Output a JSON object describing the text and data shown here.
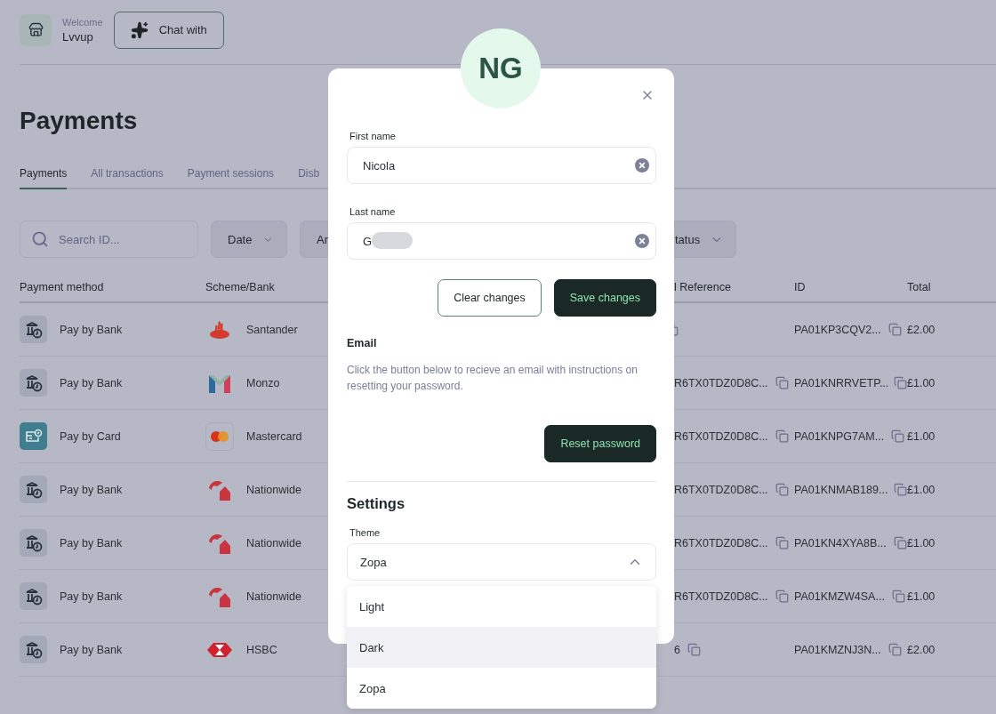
{
  "header": {
    "welcome": "Welcome",
    "name": "Lvvup",
    "chat_button": "Chat with"
  },
  "page_title": "Payments",
  "tabs": [
    {
      "label": "Payments",
      "selected": true
    },
    {
      "label": "All transactions",
      "selected": false
    },
    {
      "label": "Payment sessions",
      "selected": false
    },
    {
      "label": "Disb",
      "selected": false
    }
  ],
  "filters": {
    "search_placeholder": "Search ID...",
    "buttons": [
      {
        "label": "Date"
      },
      {
        "label": "An"
      },
      {
        "label": "tatus"
      }
    ]
  },
  "table": {
    "columns": [
      "Payment method",
      "Scheme/Bank",
      "",
      "l Reference",
      "ID",
      "Total"
    ],
    "rows": [
      {
        "method": {
          "kind": "bank",
          "label": "Pay by Bank"
        },
        "bank": {
          "kind": "flame",
          "name": "Santander"
        },
        "reference": "",
        "id": "PA01KP3CQV2...",
        "total": "£2.00"
      },
      {
        "method": {
          "kind": "bank",
          "label": "Pay by Bank"
        },
        "bank": {
          "kind": "m",
          "name": "Monzo"
        },
        "reference": "R6TX0TDZ0D8C...",
        "id": "PA01KNRRVETP...",
        "total": "£1.00"
      },
      {
        "method": {
          "kind": "card",
          "label": "Pay by Card"
        },
        "bank": {
          "kind": "circles",
          "name": "Mastercard"
        },
        "reference": "R6TX0TDZ0D8C...",
        "id": "PA01KNPG7AM...",
        "total": "£1.00"
      },
      {
        "method": {
          "kind": "bank",
          "label": "Pay by Bank"
        },
        "bank": {
          "kind": "arch",
          "name": "Nationwide"
        },
        "reference": "R6TX0TDZ0D8C...",
        "id": "PA01KNMAB189...",
        "total": "£1.00"
      },
      {
        "method": {
          "kind": "bank",
          "label": "Pay by Bank"
        },
        "bank": {
          "kind": "arch",
          "name": "Nationwide"
        },
        "reference": "R6TX0TDZ0D8C...",
        "id": "PA01KN4XYA8B...",
        "total": "£1.00"
      },
      {
        "method": {
          "kind": "bank",
          "label": "Pay by Bank"
        },
        "bank": {
          "kind": "arch",
          "name": "Nationwide"
        },
        "reference": "R6TX0TDZ0D8C...",
        "id": "PA01KMZW4SA...",
        "total": "£1.00"
      },
      {
        "method": {
          "kind": "bank",
          "label": "Pay by Bank"
        },
        "bank": {
          "kind": "hexagon",
          "name": "HSBC"
        },
        "reference": "6",
        "id": "PA01KMZNJ3N...",
        "total": "£2.00"
      }
    ]
  },
  "profile_modal": {
    "initials": "NG",
    "fields": [
      {
        "label": "First name",
        "value": "Nicola",
        "redacted": false
      },
      {
        "label": "Last name",
        "value": "G",
        "redacted": true
      }
    ],
    "buttons": [
      {
        "label": "Clear changes",
        "kind": "secondary"
      },
      {
        "label": "Save changes",
        "kind": "primary"
      }
    ],
    "email": {
      "heading": "Email",
      "text": "Click the button below to recieve an email with instructions on resetting your password.",
      "button": "Reset password"
    },
    "settings": {
      "heading": "Settings",
      "theme": {
        "label": "Theme",
        "value": "Zopa",
        "expanded": true,
        "options": [
          {
            "label": "Light",
            "highlighted": false
          },
          {
            "label": "Dark",
            "highlighted": true
          },
          {
            "label": "Zopa",
            "highlighted": false
          }
        ]
      }
    }
  }
}
